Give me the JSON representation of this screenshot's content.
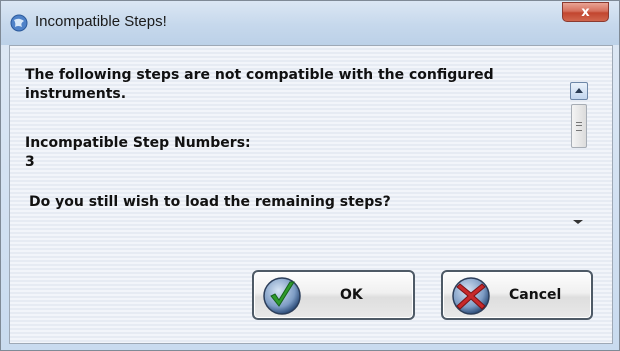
{
  "window": {
    "title": "Incompatible Steps!",
    "close_label": "x"
  },
  "message": {
    "line1": "The following steps are not compatible with the configured instruments.",
    "step_header": "Incompatible Step Numbers:",
    "step_value": "3",
    "question": "Do you still wish to load the remaining steps?"
  },
  "buttons": {
    "ok_label": "OK",
    "cancel_label": "Cancel"
  },
  "icons": {
    "title": "app-globe-icon",
    "ok": "green-checkmark-icon",
    "cancel": "red-x-icon"
  },
  "colors": {
    "ok_icon": "#2e9a2b",
    "cancel_icon": "#c7292b",
    "close_button": "#c9513b"
  }
}
